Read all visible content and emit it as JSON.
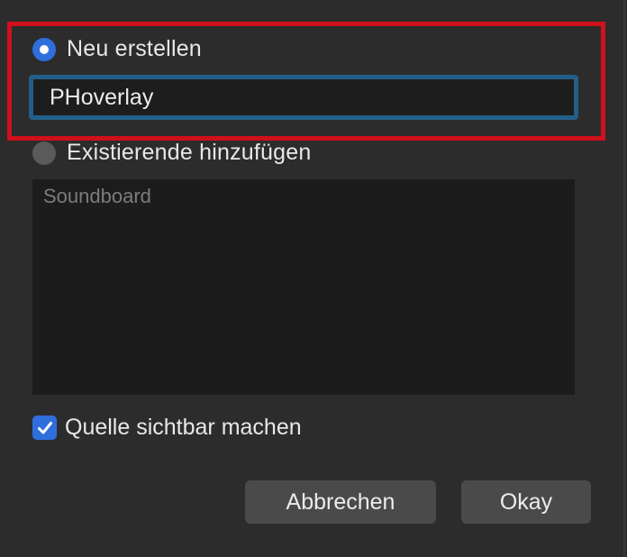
{
  "dialog": {
    "create_new": {
      "label": "Neu erstellen",
      "selected": true,
      "input_value": "PHoverlay"
    },
    "add_existing": {
      "label": "Existierende hinzufügen",
      "selected": false,
      "list_items": [
        "Soundboard"
      ]
    },
    "visible_checkbox": {
      "label": "Quelle sichtbar machen",
      "checked": true
    },
    "buttons": {
      "cancel_label": "Abbrechen",
      "ok_label": "Okay"
    }
  },
  "colors": {
    "accent": "#2f6fdc",
    "highlight": "#d0101b",
    "input_focus": "#235e8a",
    "background": "#2c2c2c"
  }
}
